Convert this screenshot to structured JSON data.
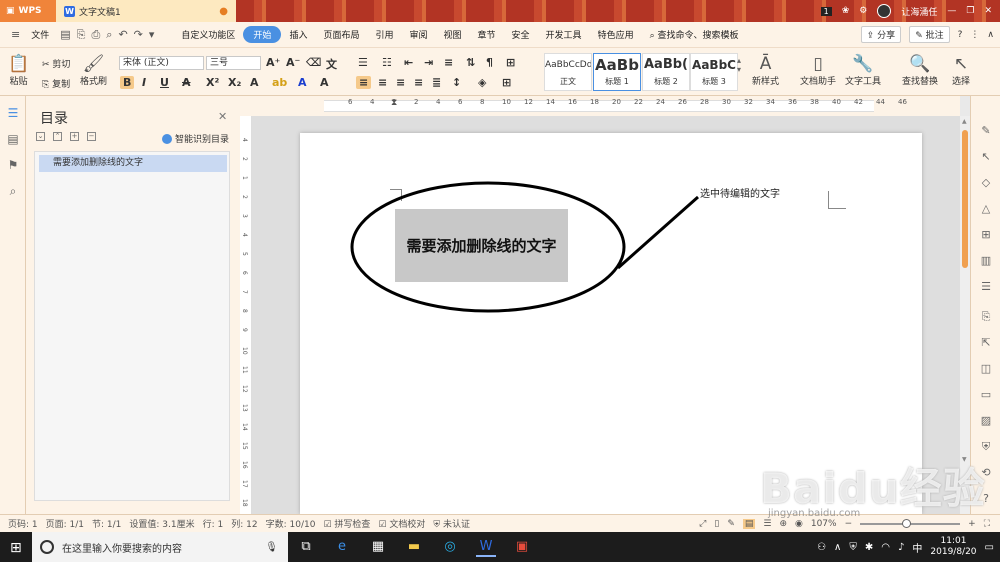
{
  "titlebar": {
    "app_label": "WPS",
    "doc_tab": "文字文稿1",
    "badge": "1",
    "user": "让海涌任"
  },
  "menubar": {
    "file": "文件",
    "items": [
      "自定义功能区",
      "开始",
      "插入",
      "页面布局",
      "引用",
      "审阅",
      "视图",
      "章节",
      "安全",
      "开发工具",
      "特色应用",
      "查找命令、搜索模板"
    ],
    "share": "分享",
    "comment": "批注"
  },
  "ribbon": {
    "paste": "粘贴",
    "cut": "剪切",
    "copy": "复制",
    "format_painter": "格式刷",
    "font_name": "宋体 (正文)",
    "font_size": "三号",
    "styles": [
      {
        "preview": "AaBbCcDd",
        "name": "正文"
      },
      {
        "preview": "AaBb",
        "name": "标题 1"
      },
      {
        "preview": "AaBb(",
        "name": "标题 2"
      },
      {
        "preview": "AaBbC",
        "name": "标题 3"
      }
    ],
    "new_style": "新样式",
    "doc_assistant": "文档助手",
    "text_tools": "文字工具",
    "find_replace": "查找替换",
    "select": "选择"
  },
  "toc": {
    "title": "目录",
    "smart": "智能识别目录",
    "items": [
      "需要添加删除线的文字"
    ]
  },
  "ruler": {
    "h_ticks": [
      "6",
      "4",
      "2",
      "2",
      "4",
      "6",
      "8",
      "10",
      "12",
      "14",
      "16",
      "18",
      "20",
      "22",
      "24",
      "26",
      "28",
      "30",
      "32",
      "34",
      "36",
      "38",
      "40",
      "42",
      "44",
      "46"
    ],
    "v_ticks": [
      "4",
      "2",
      "1",
      "2",
      "3",
      "4",
      "5",
      "6",
      "7",
      "8",
      "9",
      "10",
      "11",
      "12",
      "13",
      "14",
      "15",
      "16",
      "17",
      "18"
    ]
  },
  "document": {
    "highlighted_text": "需要添加删除线的文字",
    "callout": "选中待编辑的文字"
  },
  "statusbar": {
    "page_num": "页码: 1",
    "pages": "页面: 1/1",
    "section": "节: 1/1",
    "setting": "设置值: 3.1厘米",
    "row": "行: 1",
    "col": "列: 12",
    "words": "字数: 10/10",
    "spell": "拼写检查",
    "proofread": "文档校对",
    "cert": "未认证",
    "zoom": "107%"
  },
  "taskbar": {
    "search_placeholder": "在这里输入你要搜索的内容",
    "ime": "中",
    "time": "11:01",
    "date": "2019/8/20"
  },
  "watermark": {
    "text": "Baidu经验",
    "url": "jingyan.baidu.com"
  },
  "colors": {
    "titlebar": "#c0392b",
    "ribbon_bg": "#fdf3e7",
    "accent": "#4a90e2",
    "highlight": "#c8c8c8"
  }
}
